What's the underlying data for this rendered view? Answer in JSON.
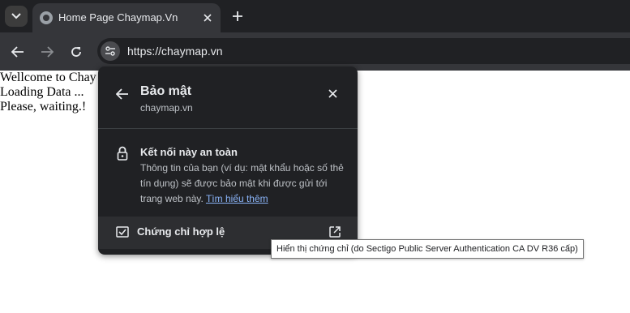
{
  "browser": {
    "tab": {
      "title": "Home Page Chaymap.Vn"
    },
    "omnibox": {
      "url": "https://chaymap.vn"
    }
  },
  "page": {
    "lines": [
      "Wellcome to Chay",
      "Loading Data ...",
      "Please, waiting.!"
    ]
  },
  "security_popup": {
    "title": "Bảo mật",
    "domain": "chaymap.vn",
    "connection": {
      "title": "Kết nối này an toàn",
      "description": "Thông tin của bạn (ví dụ: mật khẩu hoặc số thẻ tín dụng) sẽ được bảo mật khi được gửi tới trang web này.",
      "learn_more": "Tìm hiểu thêm"
    },
    "certificate": {
      "label": "Chứng chỉ hợp lệ"
    }
  },
  "tooltip": {
    "text": "Hiển thị chứng chỉ (do Sectigo Public Server Authentication CA DV R36 cấp)"
  },
  "icons": {
    "tab_search": "chevron-down-icon",
    "favicon": "globe-icon",
    "tab_close": "close-icon",
    "new_tab": "plus-icon",
    "back": "arrow-left-icon",
    "forward": "arrow-right-icon",
    "reload": "reload-icon",
    "site_info": "tune-icon",
    "popup_back": "arrow-left-icon",
    "popup_close": "close-icon",
    "lock": "lock-icon",
    "certificate": "certificate-icon",
    "open_external": "external-link-icon"
  }
}
